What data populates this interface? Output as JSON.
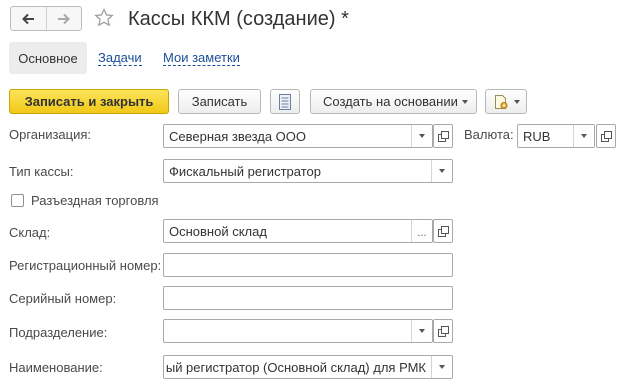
{
  "window": {
    "title": "Кассы ККМ (создание) *"
  },
  "tabs": [
    {
      "label": "Основное",
      "active": true
    },
    {
      "label": "Задачи",
      "active": false
    },
    {
      "label": "Мои заметки",
      "active": false
    }
  ],
  "toolbar": {
    "save_close_label": "Записать и закрыть",
    "save_label": "Записать",
    "create_based_label": "Создать на основании"
  },
  "form": {
    "organization": {
      "label": "Организация:",
      "value": "Северная звезда ООО"
    },
    "currency": {
      "label": "Валюта:",
      "value": "RUB"
    },
    "cash_type": {
      "label": "Тип кассы:",
      "value": "Фискальный регистратор"
    },
    "mobile_trade": {
      "label": "Разъездная торговля",
      "checked": false
    },
    "warehouse": {
      "label": "Склад:",
      "value": "Основной склад"
    },
    "reg_number": {
      "label": "Регистрационный номер:",
      "value": ""
    },
    "serial_number": {
      "label": "Серийный номер:",
      "value": ""
    },
    "department": {
      "label": "Подразделение:",
      "value": ""
    },
    "name": {
      "label": "Наименование:",
      "value": "ый регистратор (Основной склад) для РМК"
    }
  },
  "colors": {
    "primary_button": "#f5d22a",
    "link": "#1c4f97",
    "active_tab_bg": "#ececec"
  }
}
